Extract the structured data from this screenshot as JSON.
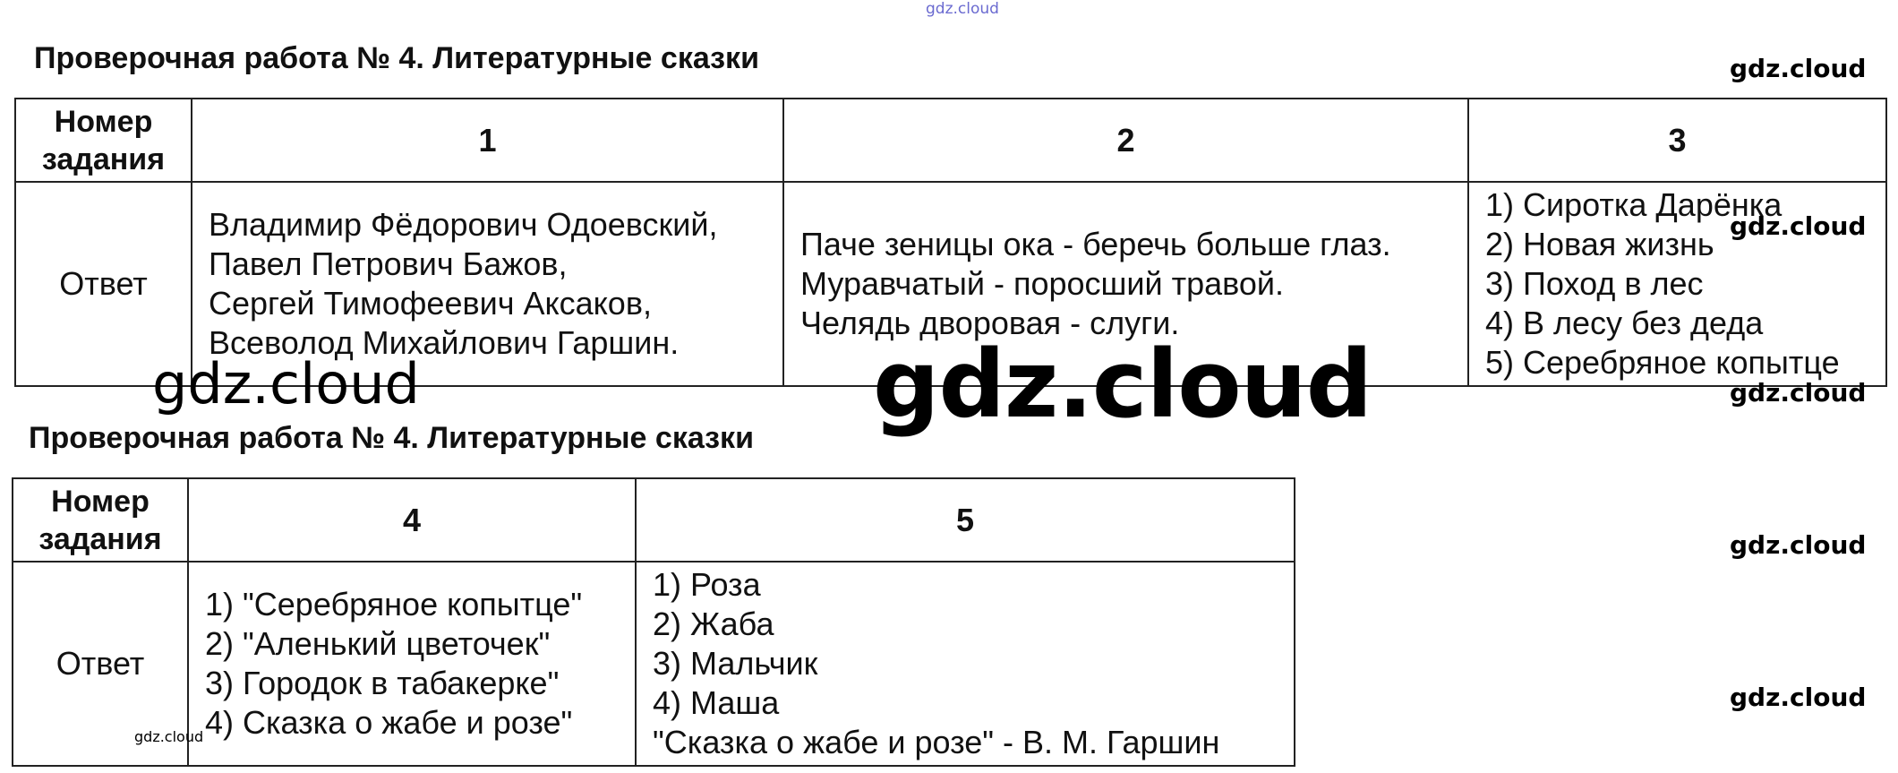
{
  "watermark": "gdz.cloud",
  "section1": {
    "heading": "Проверочная работа № 4. Литературные сказки",
    "header_label": "Номер задания",
    "answer_label": "Ответ",
    "columns": [
      {
        "number": "1",
        "lines": [
          "Владимир Фёдорович Одоевский,",
          "Павел Петрович Бажов,",
          "Сергей Тимофеевич Аксаков,",
          "Всеволод Михайлович Гаршин."
        ]
      },
      {
        "number": "2",
        "lines": [
          "Паче зеницы ока - беречь больше глаз.",
          "Муравчатый - поросший травой.",
          "Челядь дворовая - слуги."
        ]
      },
      {
        "number": "3",
        "lines": [
          "1) Сиротка Дарёнка",
          "2) Новая жизнь",
          "3) Поход в лес",
          "4) В лесу без деда",
          "5) Серебряное копытце"
        ]
      }
    ]
  },
  "section2": {
    "heading": "Проверочная работа № 4. Литературные сказки",
    "header_label": "Номер задания",
    "answer_label": "Ответ",
    "columns": [
      {
        "number": "4",
        "lines": [
          "1) \"Серебряное копытце\"",
          "2) \"Аленький цветочек\"",
          "3) Городок в табакерке\"",
          "4) Сказка о жабе и розе\""
        ]
      },
      {
        "number": "5",
        "lines": [
          "1) Роза",
          "2) Жаба",
          "3) Мальчик",
          "4) Маша",
          "\"Сказка о жабе и розе\" - В. М. Гаршин"
        ]
      }
    ]
  }
}
